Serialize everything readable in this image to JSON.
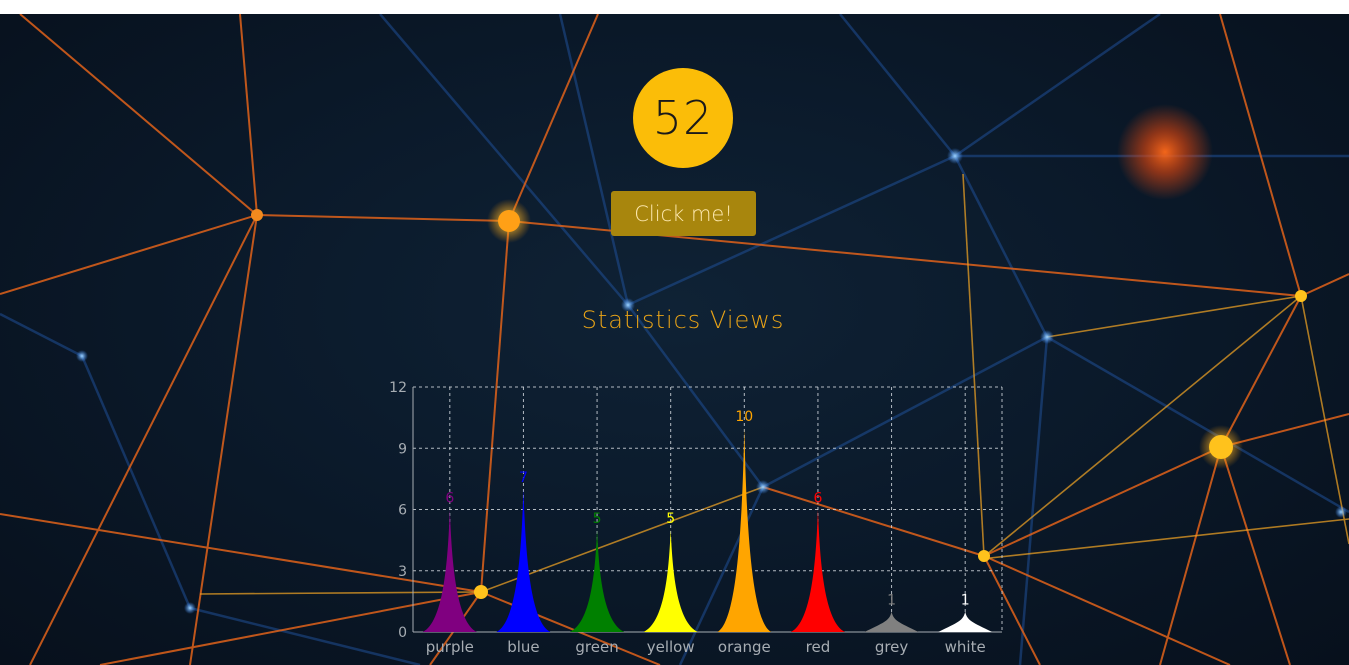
{
  "counter": {
    "value": "52"
  },
  "button": {
    "label": "Click me!"
  },
  "stats": {
    "title": "Statistics Views"
  },
  "colors": {
    "accent": "#fbbd08",
    "button_bg": "#a8860d",
    "title": "#e8a317"
  },
  "chart_data": {
    "type": "bar",
    "categories": [
      "purple",
      "blue",
      "green",
      "yellow",
      "orange",
      "red",
      "grey",
      "white"
    ],
    "values": [
      6,
      7,
      5,
      5,
      10,
      6,
      1,
      1
    ],
    "colors": [
      "#800080",
      "#0000ff",
      "#008000",
      "#ffff00",
      "#ffa500",
      "#ff0000",
      "#808080",
      "#ffffff"
    ],
    "yticks": [
      0,
      3,
      6,
      9,
      12
    ],
    "ylim": [
      0,
      12
    ],
    "grid": true,
    "bar_shape": "spike"
  }
}
